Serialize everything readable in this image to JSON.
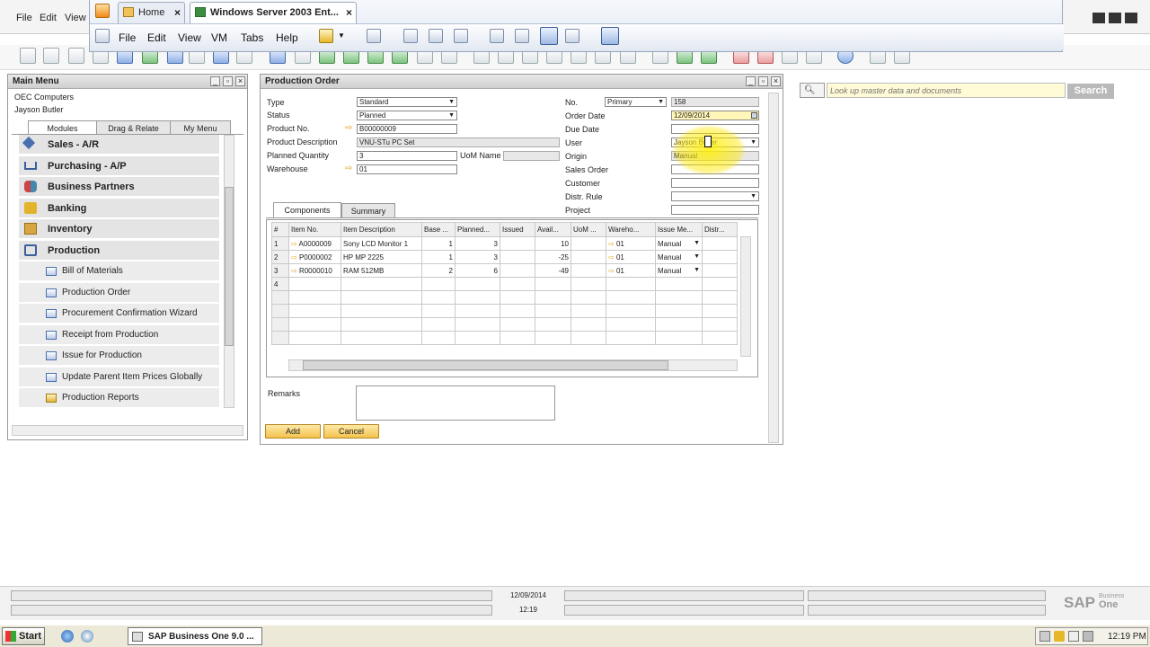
{
  "sap_menu": {
    "file": "File",
    "edit": "Edit",
    "view": "View"
  },
  "vmware": {
    "tabs": [
      {
        "label": "Home"
      },
      {
        "label": "Windows Server 2003 Ent..."
      }
    ],
    "menu": {
      "file": "File",
      "edit": "Edit",
      "view": "View",
      "vm": "VM",
      "tabs": "Tabs",
      "help": "Help"
    }
  },
  "main_menu": {
    "title": "Main Menu",
    "company": "OEC Computers",
    "user": "Jayson Butler",
    "tabs": [
      "Modules",
      "Drag & Relate",
      "My Menu"
    ],
    "modules": [
      {
        "label": "Sales - A/R",
        "icon": "sales-icon"
      },
      {
        "label": "Purchasing - A/P",
        "icon": "cart-icon"
      },
      {
        "label": "Business Partners",
        "icon": "people-icon"
      },
      {
        "label": "Banking",
        "icon": "coins-icon"
      },
      {
        "label": "Inventory",
        "icon": "box-icon"
      },
      {
        "label": "Production",
        "icon": "production-icon"
      }
    ],
    "production_items": [
      "Bill of Materials",
      "Production Order",
      "Procurement Confirmation Wizard",
      "Receipt from Production",
      "Issue for Production",
      "Update Parent Item Prices Globally",
      "Production Reports"
    ]
  },
  "production_order": {
    "title": "Production Order",
    "labels": {
      "type": "Type",
      "status": "Status",
      "product_no": "Product No.",
      "product_desc": "Product Description",
      "planned_qty": "Planned Quantity",
      "uom_name": "UoM Name",
      "warehouse": "Warehouse",
      "no": "No.",
      "order_date": "Order Date",
      "due_date": "Due Date",
      "user": "User",
      "origin": "Origin",
      "sales_order": "Sales Order",
      "customer": "Customer",
      "distr_rule": "Distr. Rule",
      "project": "Project",
      "remarks": "Remarks"
    },
    "values": {
      "type": "Standard",
      "status": "Planned",
      "product_no": "B00000009",
      "product_desc": "VNU-STu PC Set",
      "planned_qty": "3",
      "warehouse": "01",
      "series": "Primary",
      "no": "158",
      "order_date": "12/09/2014",
      "user": "Jayson Butler",
      "origin": "Manual"
    },
    "tabs": [
      "Components",
      "Summary"
    ],
    "grid": {
      "headers": [
        "#",
        "Item No.",
        "Item Description",
        "Base ...",
        "Planned...",
        "Issued",
        "Avail...",
        "UoM ...",
        "Wareho...",
        "Issue Me...",
        "Distr..."
      ],
      "rows": [
        [
          "1",
          "A0000009",
          "Sony LCD Monitor 1",
          "1",
          "3",
          "",
          "10",
          "",
          "01",
          "Manual",
          ""
        ],
        [
          "2",
          "P0000002",
          "HP MP 2225",
          "1",
          "3",
          "",
          "-25",
          "",
          "01",
          "Manual",
          ""
        ],
        [
          "3",
          "R0000010",
          "RAM 512MB",
          "2",
          "6",
          "",
          "-49",
          "",
          "01",
          "Manual",
          ""
        ],
        [
          "4",
          "",
          "",
          "",
          "",
          "",
          "",
          "",
          "",
          "",
          ""
        ]
      ]
    },
    "buttons": {
      "add": "Add",
      "cancel": "Cancel"
    }
  },
  "search": {
    "placeholder": "Look up master data and documents",
    "button": "Search"
  },
  "status": {
    "date": "12/09/2014",
    "time": "12:19"
  },
  "brand": {
    "sap": "SAP",
    "line1": "Business",
    "line2": "One"
  },
  "taskbar": {
    "start": "Start",
    "item": "SAP Business One 9.0 ...",
    "clock": "12:19 PM"
  }
}
